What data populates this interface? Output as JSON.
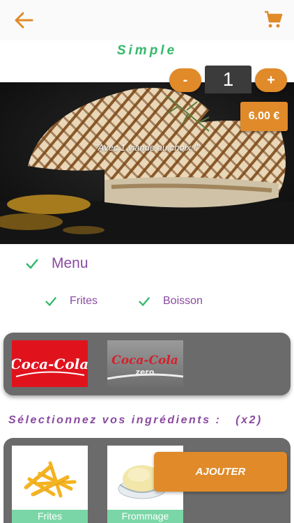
{
  "header": {
    "back_icon": "arrow-left-icon",
    "cart_icon": "cart-icon",
    "accent": "#e08a2a"
  },
  "product": {
    "title": "Simple",
    "quantity": "1",
    "minus_label": "-",
    "plus_label": "+",
    "price": "6.00 €",
    "tagline": "\"Avec 1 viande au choix !\""
  },
  "menu": {
    "label": "Menu",
    "options": [
      {
        "label": "Frites"
      },
      {
        "label": "Boisson"
      }
    ]
  },
  "drinks": [
    {
      "name": "Coca-Cola",
      "logo_text": "Coca-Cola"
    },
    {
      "name": "Coca-Cola zero",
      "logo_text": "Coca-Cola",
      "sub_text": "zero"
    }
  ],
  "ingredients": {
    "title": "Sélectionnez vos ingrédients :",
    "count": "(x2)",
    "items": [
      {
        "label": "Frites"
      },
      {
        "label": "Frommage"
      }
    ]
  },
  "add_button": {
    "label": "AJOUTER"
  },
  "colors": {
    "green": "#34b86a",
    "purple": "#8a4aa0",
    "orange": "#e08a2a",
    "panel": "#6b6b6b",
    "label_green": "#7ad6a6"
  }
}
